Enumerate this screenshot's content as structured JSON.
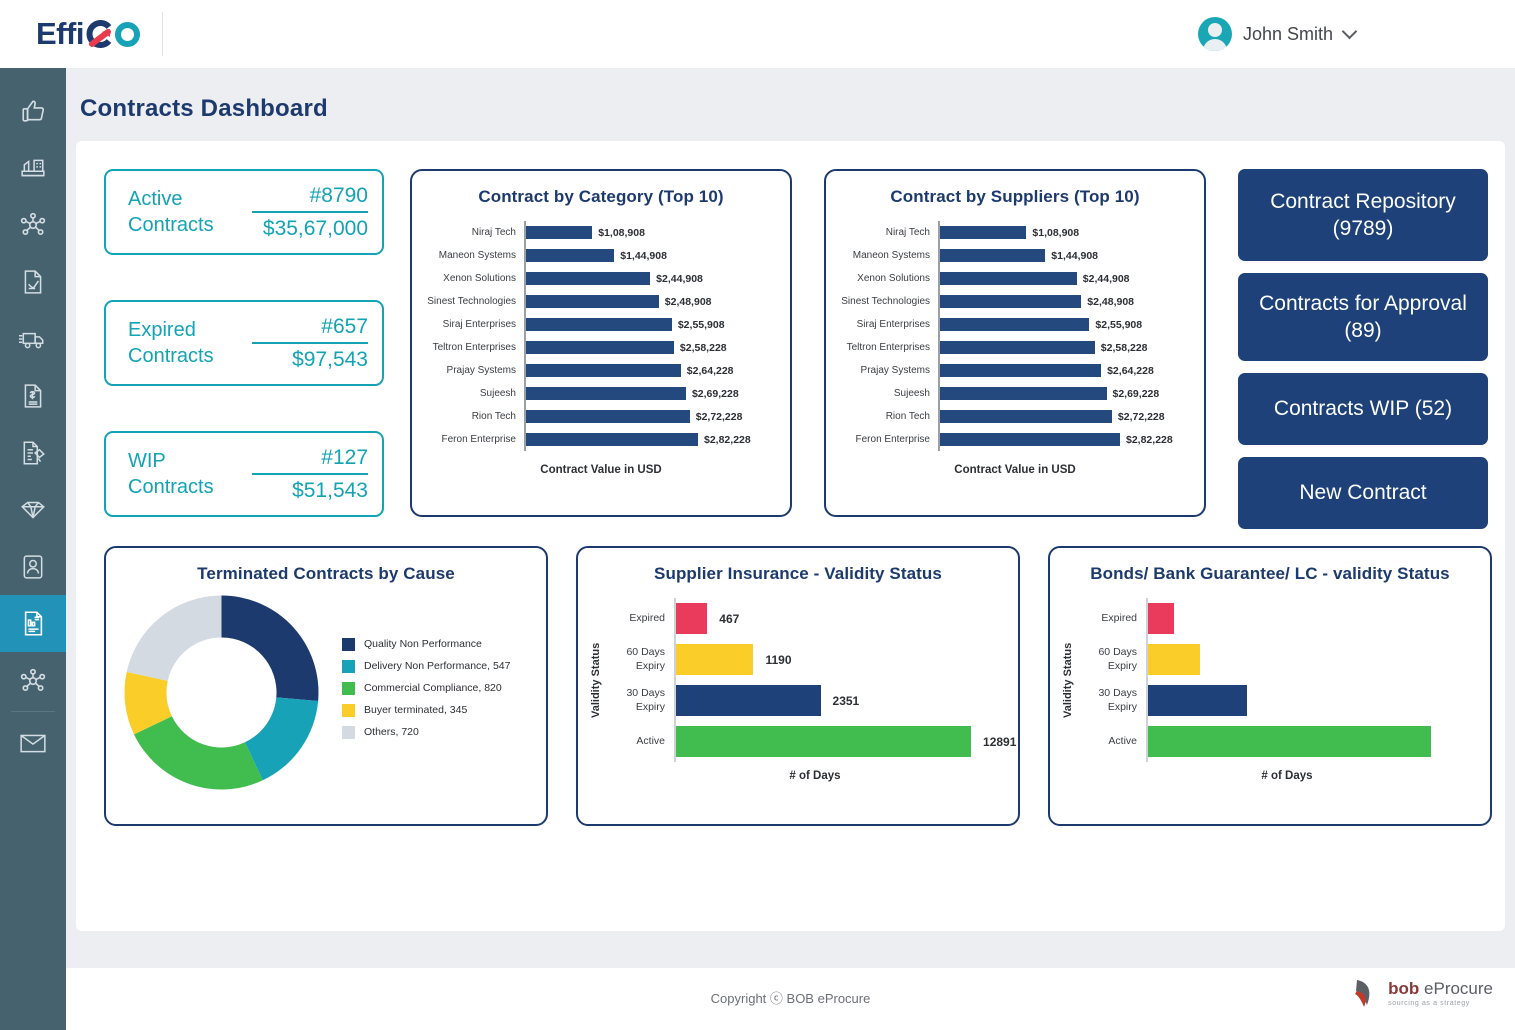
{
  "brand": {
    "logo_prefix": "Effi",
    "logo_g": "G",
    "logo_o": "O"
  },
  "header": {
    "user_name": "John Smith",
    "avatar_icon": "user-avatar-icon",
    "chevron_icon": "chevron-down-icon"
  },
  "sidebar": {
    "items": [
      {
        "name": "sidebar-item-approvals",
        "icon": "thumbs-up-icon",
        "active": false
      },
      {
        "name": "sidebar-item-plants",
        "icon": "factory-icon",
        "active": false
      },
      {
        "name": "sidebar-item-network",
        "icon": "network-icon",
        "active": false
      },
      {
        "name": "sidebar-item-requisition",
        "icon": "document-edit-icon",
        "active": false
      },
      {
        "name": "sidebar-item-logistics",
        "icon": "truck-icon",
        "active": false
      },
      {
        "name": "sidebar-item-invoices",
        "icon": "invoice-dollar-icon",
        "active": false
      },
      {
        "name": "sidebar-item-agreements",
        "icon": "contract-sign-icon",
        "active": false
      },
      {
        "name": "sidebar-item-catalog",
        "icon": "gem-icon",
        "active": false
      },
      {
        "name": "sidebar-item-suppliers",
        "icon": "user-badge-icon",
        "active": false
      },
      {
        "name": "sidebar-item-contracts",
        "icon": "contract-report-icon",
        "active": true
      },
      {
        "name": "sidebar-item-integrations",
        "icon": "network-icon",
        "active": false
      },
      {
        "name": "sidebar-item-messages",
        "icon": "envelope-icon",
        "active": false
      }
    ]
  },
  "page": {
    "title": "Contracts Dashboard"
  },
  "kpis": [
    {
      "name": "kpi-active-contracts",
      "label": "Active Contracts",
      "count": "#8790",
      "amount": "$35,67,000"
    },
    {
      "name": "kpi-expired-contracts",
      "label": "Expired Contracts",
      "count": "#657",
      "amount": "$97,543"
    },
    {
      "name": "kpi-wip-contracts",
      "label": "WIP Contracts",
      "count": "#127",
      "amount": "$51,543"
    }
  ],
  "quick_actions": [
    {
      "name": "button-contract-repository",
      "label": "Contract Repository (9789)"
    },
    {
      "name": "button-contracts-for-approval",
      "label": "Contracts for Approval (89)"
    },
    {
      "name": "button-contracts-wip",
      "label": "Contracts WIP (52)"
    },
    {
      "name": "button-new-contract",
      "label": "New Contract"
    }
  ],
  "colors": {
    "brand_navy": "#1d3a6e",
    "brand_teal": "#13a3b5",
    "bar_navy": "#24497f",
    "button_navy": "#1d4178",
    "green": "#41bd4f",
    "yellow": "#fbcd28",
    "red": "#ea3b5c",
    "grey": "#d4dae2",
    "sidebar": "#46626f",
    "sidebar_active": "#2392b8"
  },
  "chart_data": [
    {
      "name": "contract-by-category-chart",
      "type": "bar",
      "orientation": "horizontal",
      "title": "Contract by Category (Top 10)",
      "xlabel": "Contract Value in USD",
      "ylabel": "",
      "grid": false,
      "legend": "none",
      "categories": [
        "Niraj Tech",
        "Maneon Systems",
        "Xenon Solutions",
        "Sinest Technologies",
        "Siraj Enterprises",
        "Teltron Enterprises",
        "Prajay Systems",
        "Sujeesh",
        "Rion Tech",
        "Feron Enterprise"
      ],
      "values": [
        108908,
        144908,
        244908,
        248908,
        255908,
        258228,
        264228,
        269228,
        272228,
        282228
      ],
      "value_labels": [
        "$1,08,908",
        "$1,44,908",
        "$2,44,908",
        "$2,48,908",
        "$2,55,908",
        "$2,58,228",
        "$2,64,228",
        "$2,69,228",
        "$2,72,228",
        "$2,82,228"
      ],
      "bar_pct": [
        38.5,
        51.3,
        72.2,
        77.2,
        84.8,
        86.0,
        90.0,
        93.0,
        95.2,
        100.0
      ],
      "xlim": [
        0,
        282228
      ],
      "series_color": "#24497f"
    },
    {
      "name": "contract-by-suppliers-chart",
      "type": "bar",
      "orientation": "horizontal",
      "title": "Contract by Suppliers (Top 10)",
      "xlabel": "Contract Value in USD",
      "ylabel": "",
      "grid": false,
      "legend": "none",
      "categories": [
        "Niraj Tech",
        "Maneon Systems",
        "Xenon Solutions",
        "Sinest Technologies",
        "Siraj Enterprises",
        "Teltron Enterprises",
        "Prajay Systems",
        "Sujeesh",
        "Rion Tech",
        "Feron Enterprise"
      ],
      "values": [
        108908,
        144908,
        244908,
        248908,
        255908,
        258228,
        264228,
        269228,
        272228,
        282228
      ],
      "value_labels": [
        "$1,08,908",
        "$1,44,908",
        "$2,44,908",
        "$2,48,908",
        "$2,55,908",
        "$2,58,228",
        "$2,64,228",
        "$2,69,228",
        "$2,72,228",
        "$2,82,228"
      ],
      "bar_pct": [
        48.0,
        58.5,
        76.0,
        78.5,
        83.0,
        86.0,
        89.5,
        92.5,
        95.5,
        100.0
      ],
      "xlim": [
        0,
        282228
      ],
      "series_color": "#24497f"
    },
    {
      "name": "terminated-contracts-by-cause-chart",
      "type": "pie",
      "variant": "donut",
      "title": "Terminated Contracts by Cause",
      "legend": "right",
      "labels": [
        "Quality Non Performance",
        "Delivery Non Performance, 547",
        "Commercial Compliance,  820",
        "Buyer terminated, 345",
        "Others, 720"
      ],
      "slice_names": [
        "Quality Non Performance",
        "Delivery Non Performance",
        "Commercial Compliance",
        "Buyer terminated",
        "Others"
      ],
      "values": [
        870,
        547,
        820,
        345,
        720
      ],
      "slice_pct": [
        26.4,
        16.6,
        24.9,
        10.5,
        21.6
      ],
      "colors": [
        "#1d3a6e",
        "#17a2b8",
        "#41bd4f",
        "#fbcd28",
        "#d4dae2"
      ]
    },
    {
      "name": "supplier-insurance-validity-chart",
      "type": "bar",
      "orientation": "horizontal",
      "title": "Supplier Insurance - Validity Status",
      "xlabel": "# of Days",
      "ylabel": "Validity Status",
      "grid": false,
      "legend": "none",
      "categories": [
        "Expired",
        "60 Days Expiry",
        "30 Days Expiry",
        "Active"
      ],
      "values": [
        467,
        1190,
        2351,
        12891
      ],
      "value_labels": [
        "467",
        "1190",
        "2351",
        "12891"
      ],
      "bar_pct": [
        10.5,
        26.0,
        48.5,
        99.0
      ],
      "colors": [
        "#ea3b5c",
        "#fbcd28",
        "#1d4178",
        "#41bd4f"
      ],
      "xlim": [
        0,
        13000
      ]
    },
    {
      "name": "bonds-bank-guarantee-validity-chart",
      "type": "bar",
      "orientation": "horizontal",
      "title": "Bonds/ Bank Guarantee/ LC - validity Status",
      "xlabel": "# of Days",
      "ylabel": "Validity Status",
      "grid": false,
      "legend": "none",
      "categories": [
        "Expired",
        "60 Days Expiry",
        "30 Days Expiry",
        "Active"
      ],
      "values": [
        null,
        null,
        null,
        null
      ],
      "value_labels": [
        "",
        "",
        "",
        ""
      ],
      "bar_pct": [
        8.5,
        17.0,
        32.0,
        92.0
      ],
      "colors": [
        "#ea3b5c",
        "#fbcd28",
        "#1d4178",
        "#41bd4f"
      ],
      "xlim": [
        0,
        100
      ]
    }
  ],
  "footer": {
    "copyright": "Copyright ⓒ BOB eProcure",
    "bob_logo_b": "bob",
    "bob_logo_rest": " eProcure",
    "bob_tagline": "sourcing as a strategy"
  }
}
